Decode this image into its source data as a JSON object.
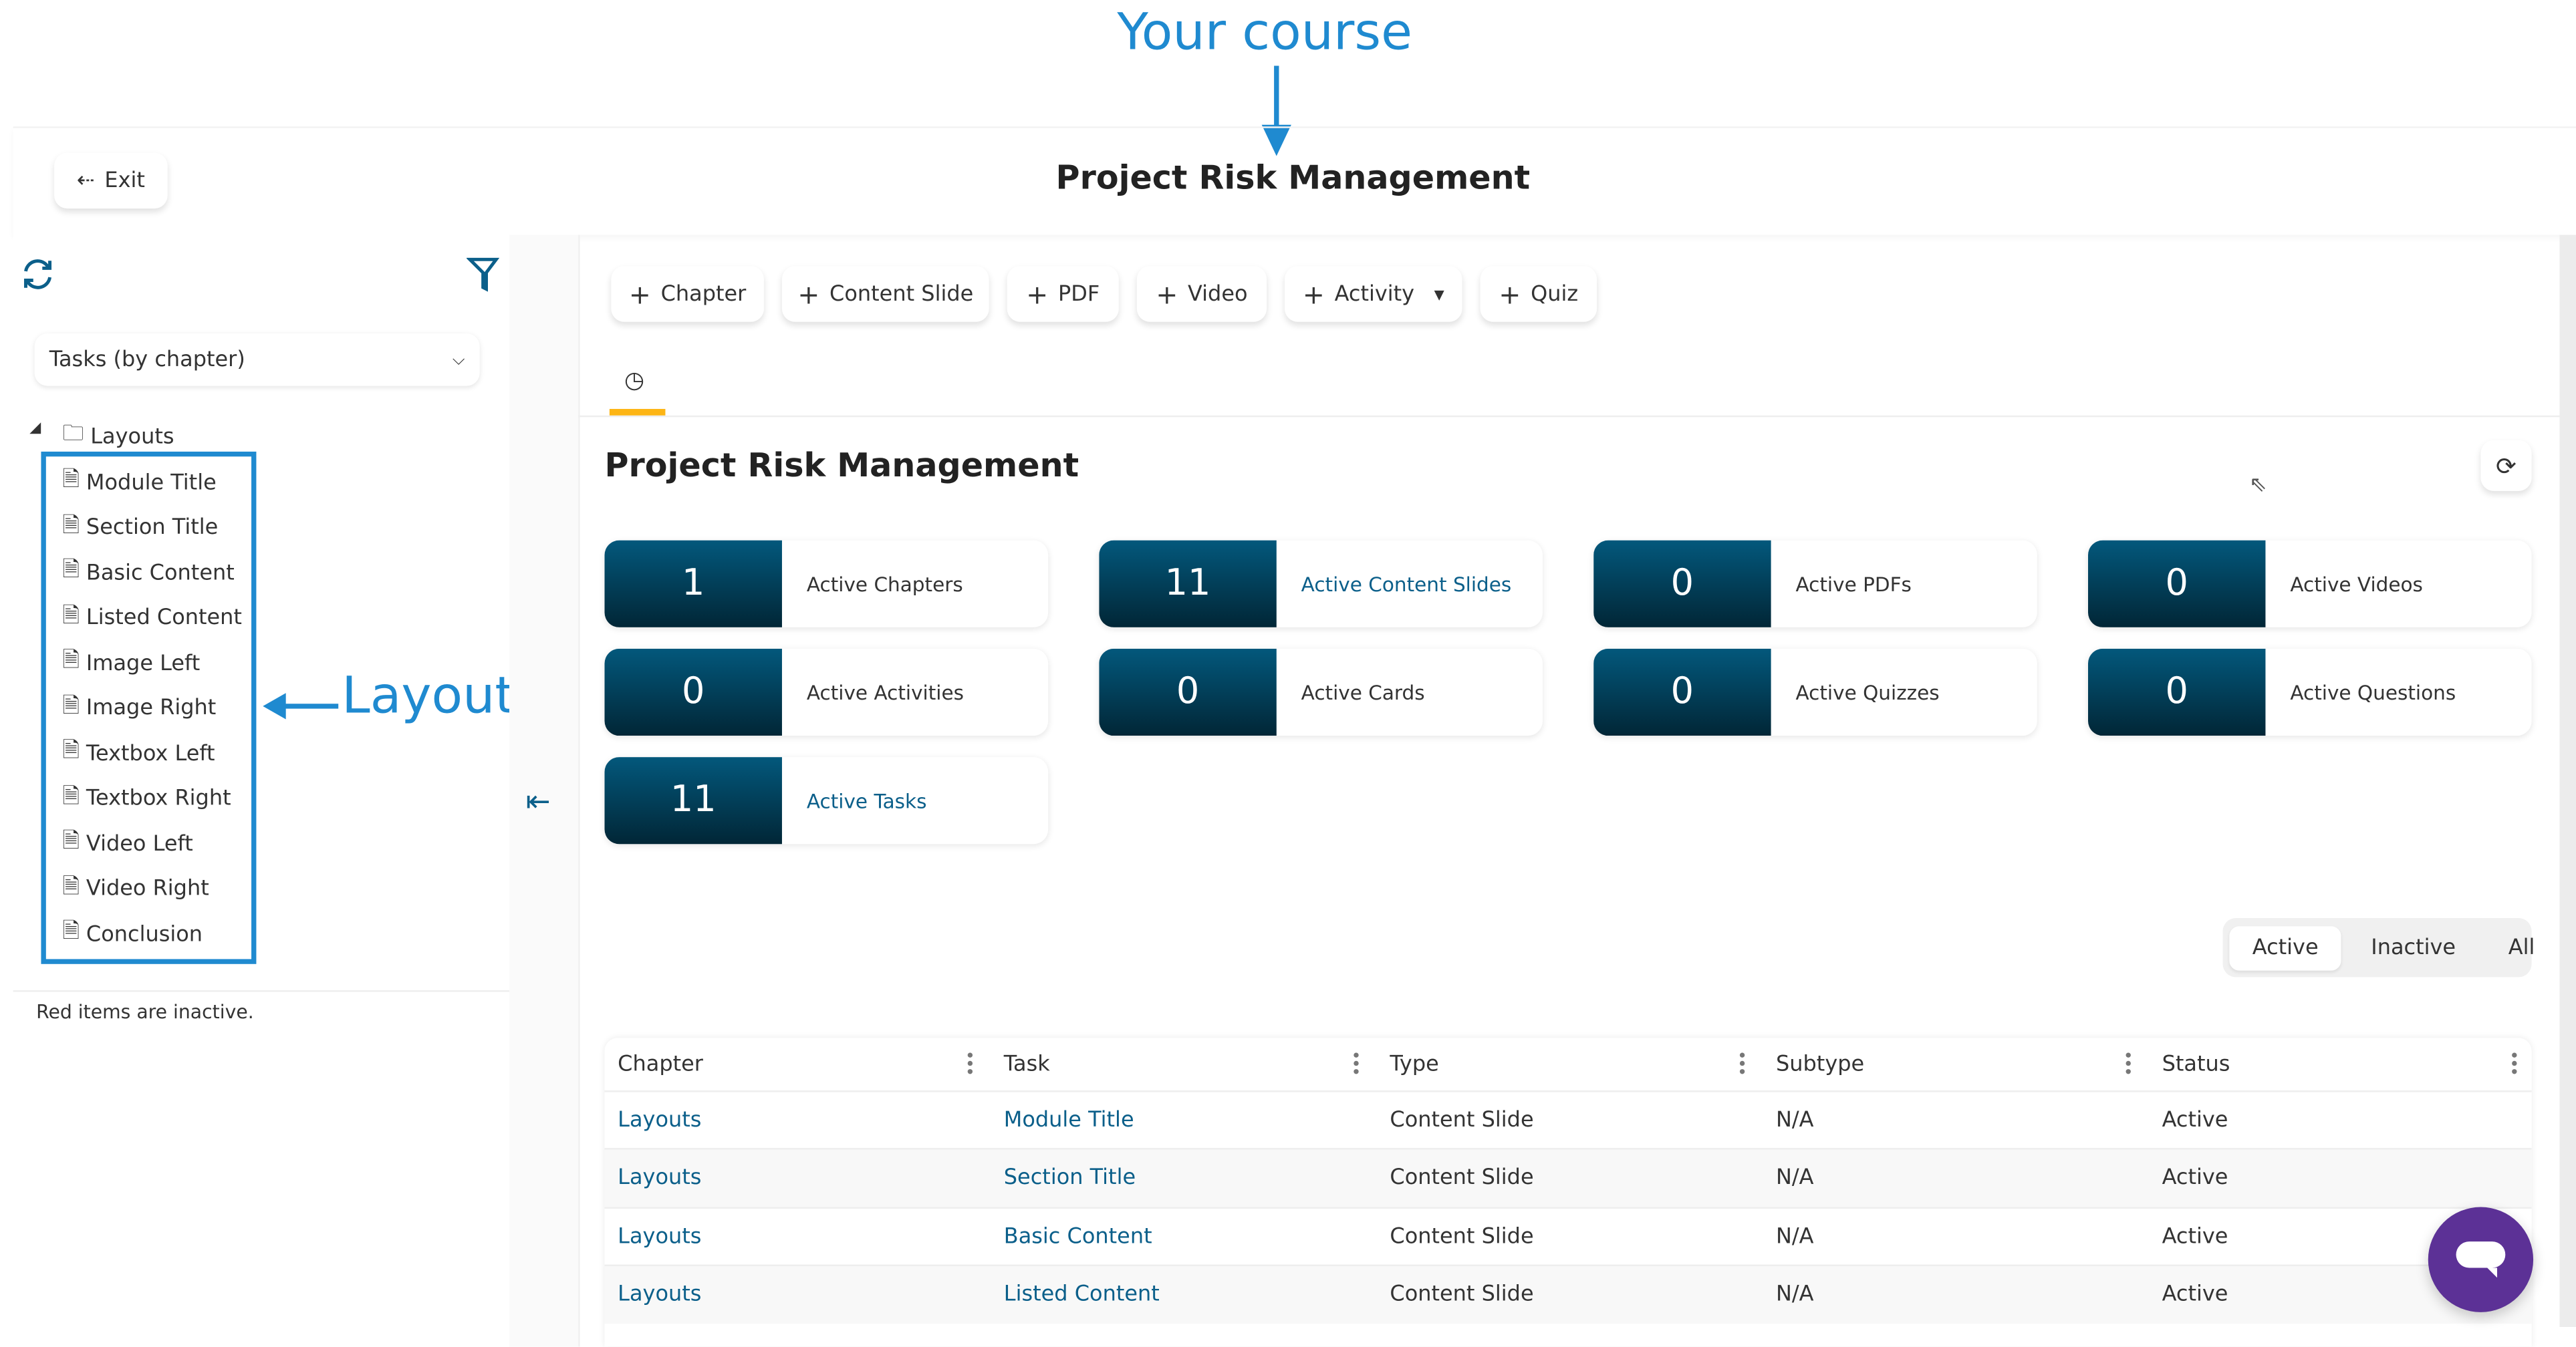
{
  "annotations": {
    "course_label": "Your course",
    "layouts_label": "Layouts"
  },
  "header": {
    "exit_label": "Exit",
    "title": "Project Risk Management"
  },
  "sidebar": {
    "view_select": "Tasks (by chapter)",
    "tree": {
      "folder": "Layouts",
      "items": [
        "Module Title",
        "Section Title",
        "Basic Content",
        "Listed Content",
        "Image Left",
        "Image Right",
        "Textbox Left",
        "Textbox Right",
        "Video Left",
        "Video Right",
        "Conclusion"
      ]
    },
    "footer_note": "Red items are inactive."
  },
  "toolbar": {
    "buttons": [
      "Chapter",
      "Content Slide",
      "PDF",
      "Video",
      "Activity",
      "Quiz"
    ]
  },
  "main": {
    "title": "Project Risk Management",
    "stats": [
      {
        "value": "1",
        "label": "Active Chapters",
        "link": false
      },
      {
        "value": "11",
        "label": "Active Content Slides",
        "link": true
      },
      {
        "value": "0",
        "label": "Active PDFs",
        "link": false
      },
      {
        "value": "0",
        "label": "Active Videos",
        "link": false
      },
      {
        "value": "0",
        "label": "Active Activities",
        "link": false
      },
      {
        "value": "0",
        "label": "Active Cards",
        "link": false
      },
      {
        "value": "0",
        "label": "Active Quizzes",
        "link": false
      },
      {
        "value": "0",
        "label": "Active Questions",
        "link": false
      },
      {
        "value": "11",
        "label": "Active Tasks",
        "link": true
      }
    ],
    "filter": {
      "options": [
        "Active",
        "Inactive",
        "All"
      ],
      "selected": "Active"
    },
    "table": {
      "columns": [
        "Chapter",
        "Task",
        "Type",
        "Subtype",
        "Status"
      ],
      "rows": [
        [
          "Layouts",
          "Module Title",
          "Content Slide",
          "N/A",
          "Active"
        ],
        [
          "Layouts",
          "Section Title",
          "Content Slide",
          "N/A",
          "Active"
        ],
        [
          "Layouts",
          "Basic Content",
          "Content Slide",
          "N/A",
          "Active"
        ],
        [
          "Layouts",
          "Listed Content",
          "Content Slide",
          "N/A",
          "Active"
        ]
      ]
    }
  },
  "colors": {
    "accent": "#0b5f8a",
    "annotation": "#1f8ad0",
    "tab_underline": "#fdb515",
    "chat": "#5c3196",
    "card_dark": "#03587c"
  }
}
